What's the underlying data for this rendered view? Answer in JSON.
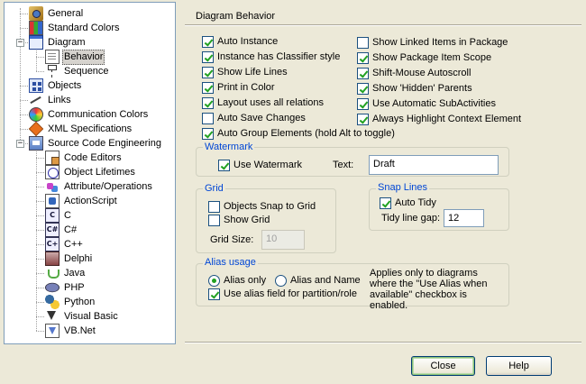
{
  "tree": {
    "items": [
      {
        "label": "General",
        "icon": "general-icon"
      },
      {
        "label": "Standard Colors",
        "icon": "palette-icon"
      },
      {
        "label": "Diagram",
        "icon": "diagram-icon",
        "expander": "−"
      },
      {
        "label": "Behavior",
        "icon": "document-icon"
      },
      {
        "label": "Sequence",
        "icon": "sequence-icon"
      },
      {
        "label": "Objects",
        "icon": "objects-icon"
      },
      {
        "label": "Links",
        "icon": "link-icon"
      },
      {
        "label": "Communication Colors",
        "icon": "color-wheel-icon"
      },
      {
        "label": "XML Specifications",
        "icon": "xml-icon"
      },
      {
        "label": "Source Code Engineering",
        "icon": "source-code-icon",
        "expander": "−"
      },
      {
        "label": "Code Editors",
        "icon": "code-editor-icon"
      },
      {
        "label": "Object Lifetimes",
        "icon": "lifetime-icon"
      },
      {
        "label": "Attribute/Operations",
        "icon": "attribute-icon"
      },
      {
        "label": "ActionScript",
        "icon": "actionscript-icon"
      },
      {
        "label": "C",
        "icon": "c-icon",
        "glyph": "C"
      },
      {
        "label": "C#",
        "icon": "csharp-icon",
        "glyph": "C#"
      },
      {
        "label": "C++",
        "icon": "cpp-icon",
        "glyph": "C+"
      },
      {
        "label": "Delphi",
        "icon": "delphi-icon"
      },
      {
        "label": "Java",
        "icon": "java-icon"
      },
      {
        "label": "PHP",
        "icon": "php-icon"
      },
      {
        "label": "Python",
        "icon": "python-icon"
      },
      {
        "label": "Visual Basic",
        "icon": "visual-basic-icon"
      },
      {
        "label": "VB.Net",
        "icon": "vbnet-icon"
      }
    ]
  },
  "section_title": "Diagram Behavior",
  "options_left": [
    {
      "label": "Auto Instance",
      "checked": true
    },
    {
      "label": "Instance has Classifier style",
      "checked": true
    },
    {
      "label": "Show Life Lines",
      "checked": true
    },
    {
      "label": "Print in Color",
      "checked": true
    },
    {
      "label": "Layout uses all relations",
      "checked": true
    },
    {
      "label": "Auto Save Changes",
      "checked": false
    },
    {
      "label": "Auto Group Elements (hold Alt to toggle)",
      "checked": true
    }
  ],
  "options_right": [
    {
      "label": "Show Linked Items in Package",
      "checked": false
    },
    {
      "label": "Show Package Item Scope",
      "checked": true
    },
    {
      "label": "Shift-Mouse Autoscroll",
      "checked": true
    },
    {
      "label": "Show 'Hidden' Parents",
      "checked": true
    },
    {
      "label": "Use Automatic SubActivities",
      "checked": true
    },
    {
      "label": "Always Highlight Context Element",
      "checked": true
    }
  ],
  "watermark": {
    "legend": "Watermark",
    "use_label": "Use Watermark",
    "use_checked": true,
    "text_label": "Text:",
    "text_value": "Draft"
  },
  "grid": {
    "legend": "Grid",
    "snap_label": "Objects Snap to Grid",
    "snap_checked": false,
    "show_label": "Show Grid",
    "show_checked": false,
    "size_label": "Grid Size:",
    "size_value": "10"
  },
  "snap_lines": {
    "legend": "Snap Lines",
    "auto_tidy_label": "Auto Tidy",
    "auto_tidy_checked": true,
    "gap_label": "Tidy line gap:",
    "gap_value": "12"
  },
  "alias": {
    "legend": "Alias usage",
    "alias_only_label": "Alias only",
    "alias_only_selected": true,
    "alias_and_name_label": "Alias and Name",
    "alias_and_name_selected": false,
    "partition_label": "Use alias field for partition/role",
    "partition_checked": true,
    "note": "Applies only to diagrams where the \"Use Alias when available\" checkbox is enabled."
  },
  "buttons": {
    "close": "Close",
    "help": "Help"
  }
}
